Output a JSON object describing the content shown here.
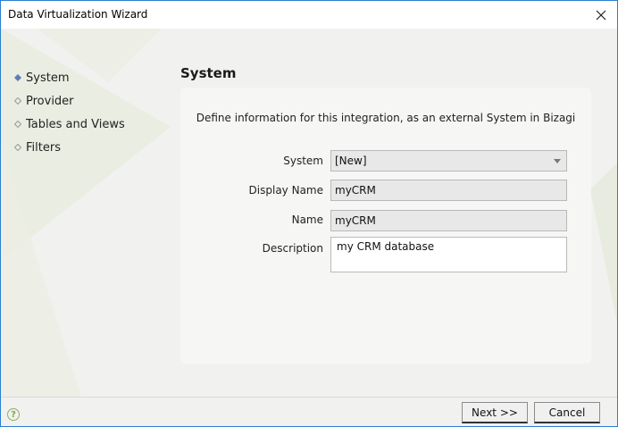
{
  "window": {
    "title": "Data Virtualization Wizard"
  },
  "steps": [
    {
      "label": "System",
      "active": true
    },
    {
      "label": "Provider",
      "active": false
    },
    {
      "label": "Tables and Views",
      "active": false
    },
    {
      "label": "Filters",
      "active": false
    }
  ],
  "section": {
    "title": "System",
    "intro": "Define information for this integration, as an external System in Bizagi"
  },
  "form": {
    "system": {
      "label": "System",
      "value": "[New]"
    },
    "display_name": {
      "label": "Display Name",
      "value": "myCRM"
    },
    "name": {
      "label": "Name",
      "value": "myCRM"
    },
    "description": {
      "label": "Description",
      "value": "my CRM database"
    }
  },
  "footer": {
    "help": "?",
    "next_label": "Next >>",
    "cancel_label": "Cancel"
  },
  "colors": {
    "bullet_active": "#5b7fb5",
    "bullet_inactive": "#9a9a9a",
    "help_green": "#8ab35a",
    "window_border": "#2b7fd0"
  }
}
